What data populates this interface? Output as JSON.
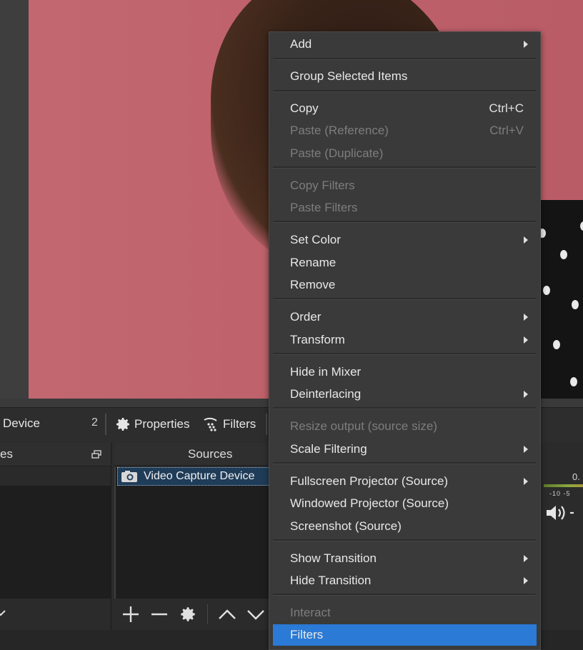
{
  "toolbar": {
    "source_name": "Device",
    "count": "2",
    "properties_label": "Properties",
    "filters_label": "Filters"
  },
  "scenes_dock": {
    "title": "es"
  },
  "sources_dock": {
    "title": "Sources",
    "items": [
      {
        "label": "Video Capture Device"
      }
    ]
  },
  "mixer": {
    "level": "0.",
    "ticks": "-10 -5"
  },
  "context_menu": {
    "items": {
      "add": "Add",
      "group_selected": "Group Selected Items",
      "copy": "Copy",
      "copy_shortcut": "Ctrl+C",
      "paste_reference": "Paste (Reference)",
      "paste_reference_shortcut": "Ctrl+V",
      "paste_duplicate": "Paste (Duplicate)",
      "copy_filters": "Copy Filters",
      "paste_filters": "Paste Filters",
      "set_color": "Set Color",
      "rename": "Rename",
      "remove": "Remove",
      "order": "Order",
      "transform": "Transform",
      "hide_in_mixer": "Hide in Mixer",
      "deinterlacing": "Deinterlacing",
      "resize_output": "Resize output (source size)",
      "scale_filtering": "Scale Filtering",
      "fullscreen_projector": "Fullscreen Projector (Source)",
      "windowed_projector": "Windowed Projector (Source)",
      "screenshot": "Screenshot (Source)",
      "show_transition": "Show Transition",
      "hide_transition": "Hide Transition",
      "interact": "Interact",
      "filters": "Filters"
    }
  },
  "colors": {
    "highlight": "#2a7ad6",
    "menu_bg": "#3a3a3a",
    "disabled_text": "#7d7d7d",
    "selection": "#1f3c58"
  }
}
